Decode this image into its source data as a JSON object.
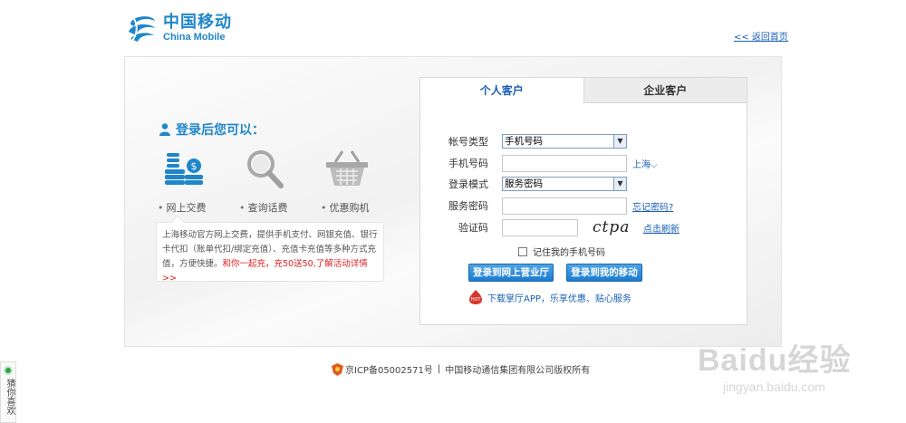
{
  "header": {
    "logo_cn": "中国移动",
    "logo_en": "China Mobile",
    "back_home": "<< 返回首页"
  },
  "promo": {
    "title": "登录后您可以：",
    "features": [
      {
        "label": "网上交费",
        "icon": "coins-icon"
      },
      {
        "label": "查询话费",
        "icon": "magnifier-icon"
      },
      {
        "label": "优惠购机",
        "icon": "basket-icon"
      }
    ],
    "description": "上海移动官方网上交费，提供手机支付、网银充值、银行卡代扣（账单代扣/绑定充值）、充值卡充值等多种方式充值，方便快捷。",
    "highlight": "和你一起充，充50送50,了解活动详情>>"
  },
  "login": {
    "tabs": [
      {
        "label": "个人客户",
        "active": true
      },
      {
        "label": "企业客户",
        "active": false
      }
    ],
    "account_type_label": "帐号类型",
    "account_type_value": "手机号码",
    "phone_label": "手机号码",
    "region_label": "上海",
    "login_mode_label": "登录模式",
    "login_mode_value": "服务密码",
    "password_label": "服务密码",
    "forgot_password": "忘记密码?",
    "captcha_label": "验证码",
    "captcha_text": "ctpa",
    "refresh_captcha": "点击刷新",
    "remember_label": "记住我的手机号码",
    "btn_hall": "登录到网上营业厅",
    "btn_mymobile": "登录到我的移动",
    "app_text": "下载掌厅APP，乐享优惠、贴心服务"
  },
  "footer": {
    "icp": "京ICP备05002571号",
    "separator": "|",
    "copyright": "中国移动通信集团有限公司版权所有"
  },
  "side_widget": {
    "label": "猜你喜欢"
  },
  "watermark": {
    "big": "Baidu经验",
    "small": "jingyan.baidu.com"
  },
  "colors": {
    "brand_blue": "#1e86c9",
    "link_blue": "#1a5fb4",
    "promo_red": "#e02020",
    "button_blue": "#2a8ad8"
  }
}
